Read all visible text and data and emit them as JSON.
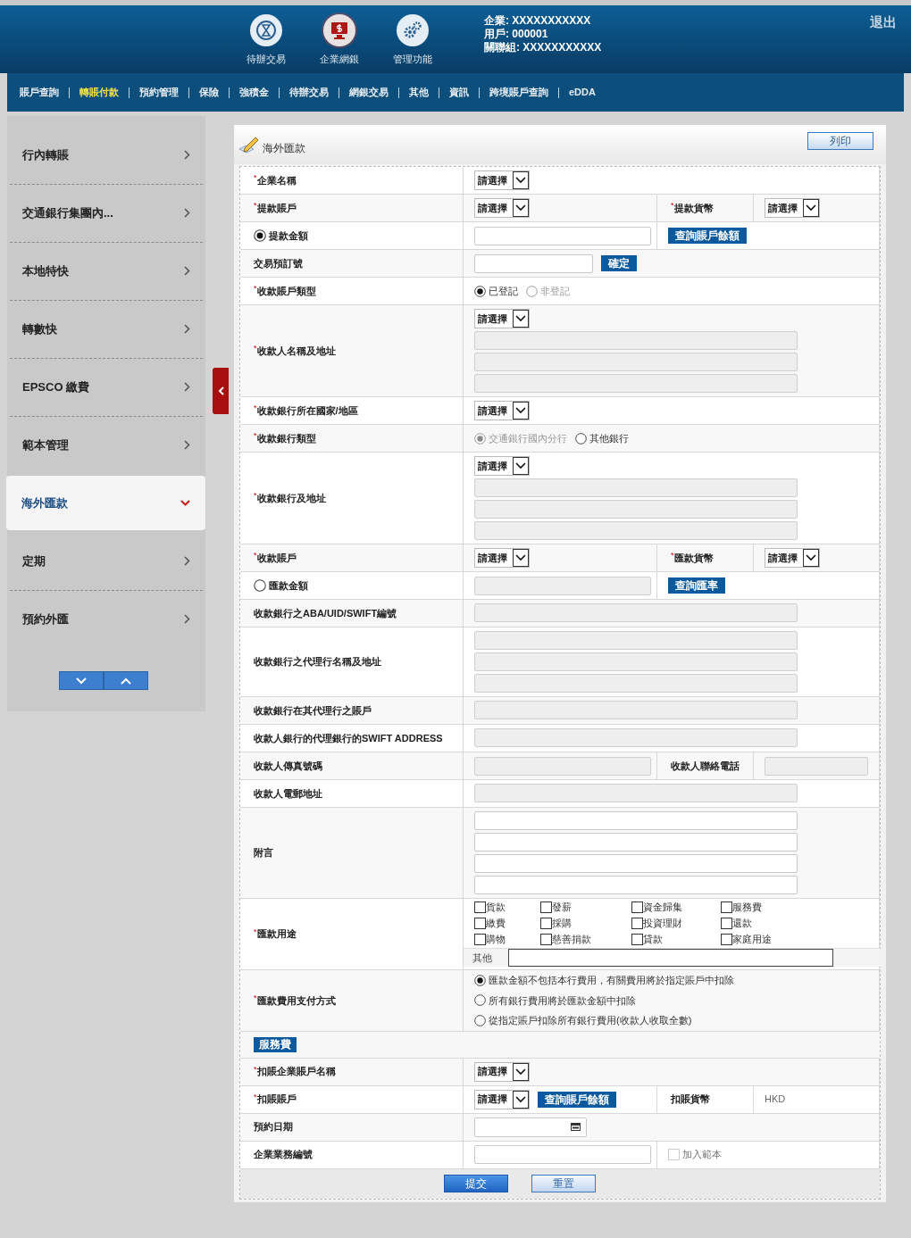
{
  "header": {
    "apps": [
      {
        "label": "待辦交易",
        "selected": false
      },
      {
        "label": "企業網銀",
        "selected": true
      },
      {
        "label": "管理功能",
        "selected": false
      }
    ],
    "user_info": [
      "企業: XXXXXXXXXXX",
      "用戶: 000001",
      "關聯組: XXXXXXXXXXX"
    ],
    "logout": "退出"
  },
  "nav": [
    {
      "label": "賬戶查詢",
      "selected": false
    },
    {
      "label": "轉賬付款",
      "selected": true
    },
    {
      "label": "預約管理",
      "selected": false
    },
    {
      "label": "保險",
      "selected": false
    },
    {
      "label": "強積金",
      "selected": false
    },
    {
      "label": "待辦交易",
      "selected": false
    },
    {
      "label": "網銀交易",
      "selected": false
    },
    {
      "label": "其他",
      "selected": false
    },
    {
      "label": "資訊",
      "selected": false
    },
    {
      "label": "跨境賬戶查詢",
      "selected": false
    },
    {
      "label": "eDDA",
      "selected": false
    }
  ],
  "sidebar": {
    "items": [
      {
        "label": "行內轉賬",
        "selected": false
      },
      {
        "label": "交通銀行集團內...",
        "selected": false
      },
      {
        "label": "本地特快",
        "selected": false
      },
      {
        "label": "轉數快",
        "selected": false
      },
      {
        "label": "EPSCO 繳費",
        "selected": false
      },
      {
        "label": "範本管理",
        "selected": false
      },
      {
        "label": "海外匯款",
        "selected": true
      },
      {
        "label": "定期",
        "selected": false
      },
      {
        "label": "預約外匯",
        "selected": false
      }
    ]
  },
  "panel": {
    "title": "海外匯款",
    "print_button": "列印"
  },
  "rows": [
    {
      "kind": "field",
      "mark": "*",
      "label": "企業名稱",
      "value": [
        {
          "kind": "select",
          "value": "請選擇"
        }
      ]
    },
    {
      "kind": "field",
      "mark": "*",
      "label": "提款賬戶",
      "value": [
        {
          "kind": "select",
          "value": "請選擇"
        }
      ],
      "mark2": "*",
      "label2": "提款貨幣",
      "value2": [
        {
          "kind": "select",
          "value": "請選擇"
        }
      ]
    },
    {
      "kind": "field",
      "radio": {
        "selected": true
      },
      "label": "提款金額",
      "value": [
        {
          "kind": "input",
          "disabled": false
        }
      ],
      "value2": [
        {
          "kind": "button",
          "label": "查詢賬戶餘額"
        }
      ]
    },
    {
      "kind": "field",
      "label": "交易預訂號",
      "value": [
        {
          "kind": "short_input",
          "disabled": false
        },
        {
          "kind": "button",
          "label": "確定"
        }
      ]
    },
    {
      "kind": "field",
      "mark": "*",
      "label": "收款賬戶類型",
      "value": [
        {
          "kind": "radio",
          "label": "已登記",
          "selected": true,
          "disabled": false
        },
        {
          "kind": "radio",
          "label": "非登記",
          "selected": false,
          "disabled": true
        }
      ]
    },
    {
      "kind": "field",
      "mark": "*",
      "label": "收款人名稱及地址",
      "value": [
        {
          "kind": "select",
          "value": "請選擇"
        },
        {
          "kind": "line",
          "disabled": true
        },
        {
          "kind": "line",
          "disabled": true
        },
        {
          "kind": "line",
          "disabled": true
        }
      ]
    },
    {
      "kind": "field",
      "mark": "*",
      "label": "收款銀行所在國家/地區",
      "value": [
        {
          "kind": "select",
          "value": "請選擇"
        }
      ]
    },
    {
      "kind": "field",
      "mark": "*",
      "label": "收款銀行類型",
      "value": [
        {
          "kind": "radio",
          "label": "交通銀行國內分行",
          "selected": true,
          "disabled": true
        },
        {
          "kind": "radio",
          "label": "其他銀行",
          "selected": false,
          "disabled": false
        }
      ]
    },
    {
      "kind": "field",
      "mark": "*",
      "label": "收款銀行及地址",
      "value": [
        {
          "kind": "select",
          "value": "請選擇"
        },
        {
          "kind": "line",
          "disabled": true
        },
        {
          "kind": "line",
          "disabled": true
        },
        {
          "kind": "line",
          "disabled": true
        }
      ]
    },
    {
      "kind": "field",
      "mark": "*",
      "label": "收款賬戶",
      "value": [
        {
          "kind": "select",
          "value": "請選擇"
        }
      ],
      "mark2": "*",
      "label2": "匯款貨幣",
      "value2": [
        {
          "kind": "select",
          "value": "請選擇"
        }
      ]
    },
    {
      "kind": "field",
      "radio": {
        "selected": false
      },
      "label": "匯款金額",
      "value": [
        {
          "kind": "input",
          "disabled": true
        }
      ],
      "value2": [
        {
          "kind": "button",
          "label": "查詢匯率"
        }
      ]
    },
    {
      "kind": "field",
      "label": "收款銀行之ABA/UID/SWIFT編號",
      "value": [
        {
          "kind": "line",
          "disabled": true
        }
      ]
    },
    {
      "kind": "field",
      "label": "收款銀行之代理行名稱及地址",
      "value": [
        {
          "kind": "line",
          "disabled": true
        },
        {
          "kind": "line",
          "disabled": true
        },
        {
          "kind": "line",
          "disabled": true
        }
      ]
    },
    {
      "kind": "field",
      "label": "收款銀行在其代理行之賬戶",
      "value": [
        {
          "kind": "line",
          "disabled": true
        }
      ]
    },
    {
      "kind": "field",
      "label": "收款人銀行的代理銀行的SWIFT ADDRESS",
      "value": [
        {
          "kind": "line",
          "disabled": true
        }
      ]
    },
    {
      "kind": "field",
      "label": "收款人傳真號碼",
      "value": [
        {
          "kind": "input",
          "disabled": true
        }
      ],
      "label2": "收款人聯絡電話",
      "value2": [
        {
          "kind": "input",
          "disabled": true
        }
      ]
    },
    {
      "kind": "field",
      "label": "收款人電郵地址",
      "value": [
        {
          "kind": "line",
          "disabled": true
        }
      ]
    },
    {
      "kind": "field",
      "label": "附言",
      "value": [
        {
          "kind": "line",
          "disabled": false
        },
        {
          "kind": "line",
          "disabled": false
        },
        {
          "kind": "line",
          "disabled": false
        },
        {
          "kind": "line",
          "disabled": false
        }
      ]
    },
    {
      "kind": "field",
      "mark": "*",
      "label": "匯款用途",
      "value": [
        {
          "kind": "checkbox_grid",
          "options": [
            {
              "label": "貨款",
              "checked": false
            },
            {
              "label": "發薪",
              "checked": false
            },
            {
              "label": "資金歸集",
              "checked": false
            },
            {
              "label": "服務費",
              "checked": false
            },
            {
              "label": "繳費",
              "checked": false
            },
            {
              "label": "採購",
              "checked": false
            },
            {
              "label": "投資理財",
              "checked": false
            },
            {
              "label": "還款",
              "checked": false
            },
            {
              "label": "購物",
              "checked": false
            },
            {
              "label": "慈善捐款",
              "checked": false
            },
            {
              "label": "貸款",
              "checked": false
            },
            {
              "label": "家庭用途",
              "checked": false
            }
          ],
          "other_label": "其他"
        }
      ]
    },
    {
      "kind": "field",
      "mark": "*",
      "label": "匯款費用支付方式",
      "value": [
        {
          "kind": "radio_list",
          "options": [
            {
              "label": "匯款金額不包括本行費用，有關費用將於指定賬戶中扣除",
              "selected": true
            },
            {
              "label": "所有銀行費用將於匯款金額中扣除",
              "selected": false
            },
            {
              "label": "從指定賬戶扣除所有銀行費用(收款人收取全數)",
              "selected": false
            }
          ]
        }
      ]
    },
    {
      "kind": "section",
      "label": "服務費"
    },
    {
      "kind": "field",
      "mark": "*",
      "label": "扣賬企業賬戶名稱",
      "value": [
        {
          "kind": "select",
          "value": "請選擇"
        }
      ]
    },
    {
      "kind": "field",
      "mark": "*",
      "label": "扣賬賬戶",
      "value": [
        {
          "kind": "select",
          "value": "請選擇"
        },
        {
          "kind": "button",
          "label": "查詢賬戶餘額"
        }
      ],
      "label2": "扣賬貨幣",
      "value2": [
        {
          "kind": "text",
          "text": "HKD"
        }
      ]
    },
    {
      "kind": "field",
      "label": "預約日期",
      "value": [
        {
          "kind": "date"
        }
      ]
    },
    {
      "kind": "field",
      "label": "企業業務編號",
      "value": [
        {
          "kind": "input",
          "disabled": false
        }
      ],
      "value2": [
        {
          "kind": "checkbox",
          "label": "加入範本",
          "checked": false,
          "disabled": true
        }
      ]
    }
  ],
  "buttons": [
    {
      "label": "提交",
      "kind": "primary"
    },
    {
      "label": "重置",
      "kind": "secondary"
    }
  ]
}
